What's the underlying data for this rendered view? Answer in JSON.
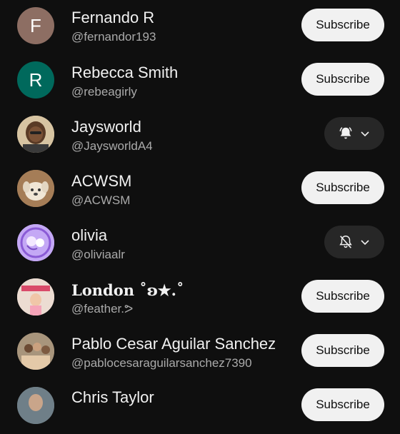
{
  "subscriptions": [
    {
      "name": "Fernando R",
      "handle": "@fernandor193",
      "avatar_letter": "F",
      "avatar_color": "#8d6e63",
      "button": "subscribe"
    },
    {
      "name": "Rebecca Smith",
      "handle": "@rebeagirly",
      "avatar_letter": "R",
      "avatar_color": "#00695c",
      "button": "subscribe"
    },
    {
      "name": "Jaysworld",
      "handle": "@JaysworldA4",
      "avatar_letter": "",
      "avatar_color": "#c9b08a",
      "button": "bell-all"
    },
    {
      "name": "ACWSM",
      "handle": "@ACWSM",
      "avatar_letter": "",
      "avatar_color": "#b58e62",
      "button": "subscribe"
    },
    {
      "name": "olivia",
      "handle": "@oliviaalr",
      "avatar_letter": "",
      "avatar_color": "#b99cf0",
      "button": "bell-off"
    },
    {
      "name": "London ˚ʚ★.˚",
      "handle": "@feather.ᕗ",
      "avatar_letter": "",
      "avatar_color": "#e9d8cf",
      "button": "subscribe"
    },
    {
      "name": "Pablo Cesar Aguilar Sanchez",
      "handle": "@pablocesaraguilarsanchez7390",
      "avatar_letter": "",
      "avatar_color": "#9e8a72",
      "button": "subscribe"
    },
    {
      "name": "Chris Taylor",
      "handle": "",
      "avatar_letter": "",
      "avatar_color": "#6b7b86",
      "button": "subscribe"
    }
  ],
  "labels": {
    "subscribe": "Subscribe"
  },
  "icons": {
    "bell_all": "bell-filled-icon",
    "bell_off": "bell-off-icon",
    "chevron": "chevron-down-icon"
  }
}
